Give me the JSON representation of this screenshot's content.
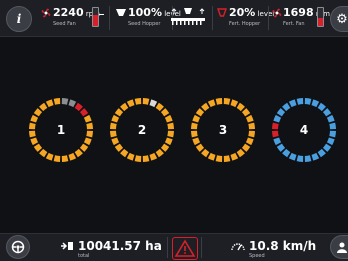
{
  "topbar": {
    "info_icon": "i",
    "seed_fan": {
      "value": "2240",
      "unit": " rpm",
      "label": "Seed Fan"
    },
    "seed_hopper": {
      "value": "100%",
      "unit": " level",
      "label": "Seed Hopper"
    },
    "fert_hopper": {
      "value": "20%",
      "unit": " level",
      "label": "Fert. Hopper"
    },
    "fert_fan": {
      "value": "1698",
      "unit": " rpm",
      "label": "Fert. Fan"
    }
  },
  "rings": [
    {
      "label": "1",
      "segments": 24,
      "base_color": "#f5a623",
      "highlights": [
        {
          "index": 0,
          "color": "#8a8d93"
        },
        {
          "index": 1,
          "color": "#8a8d93"
        },
        {
          "index": 2,
          "color": "#d8202b"
        },
        {
          "index": 3,
          "color": "#d8202b"
        }
      ]
    },
    {
      "label": "2",
      "segments": 24,
      "base_color": "#f5a623",
      "highlights": [
        {
          "index": 1,
          "color": "#d8d8d8"
        }
      ]
    },
    {
      "label": "3",
      "segments": 24,
      "base_color": "#f5a623",
      "highlights": []
    },
    {
      "label": "4",
      "segments": 24,
      "base_color": "#4a9fe0",
      "highlights": [
        {
          "index": 17,
          "color": "#d8202b"
        },
        {
          "index": 18,
          "color": "#d8202b"
        }
      ]
    }
  ],
  "bottombar": {
    "total_value": "10041.57 ha",
    "total_label": "total",
    "speed_value": "10.8 km/h",
    "speed_label": "Speed"
  },
  "colors": {
    "accent_red": "#d8202b",
    "accent_orange": "#f5a623",
    "accent_blue": "#4a9fe0"
  }
}
